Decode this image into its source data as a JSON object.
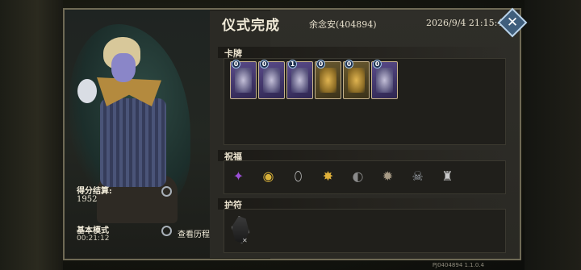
{
  "header": {
    "title": "仪式完成",
    "player": "余念安(404894)",
    "datetime": "2026/9/4 21:15:43"
  },
  "left": {
    "score_label": "得分结算:",
    "score_value": "1952",
    "mode_label": "基本模式",
    "mode_time": "00:21:12",
    "history_label": "查看历程"
  },
  "sections": {
    "cards": "卡牌",
    "blessings": "祝福",
    "amulet": "护符"
  },
  "cards": [
    {
      "cost": "0",
      "style": "purple",
      "icon": "vase-card-art"
    },
    {
      "cost": "0",
      "style": "purple",
      "icon": "scroll-card-art"
    },
    {
      "cost": "1",
      "style": "purple",
      "icon": "tentacle-card-art"
    },
    {
      "cost": "0",
      "style": "gold",
      "icon": "gold-figure-card-art"
    },
    {
      "cost": "0",
      "style": "gold",
      "icon": "gold-crab-card-art"
    },
    {
      "cost": "0",
      "style": "purple",
      "icon": "hand-card-art"
    }
  ],
  "blessings": [
    {
      "icon": "spellbook-icon",
      "glyph": "✦",
      "color": "#9b4fd6"
    },
    {
      "icon": "golden-eye-icon",
      "glyph": "◉",
      "color": "#d9b23a"
    },
    {
      "icon": "cracked-egg-icon",
      "glyph": "⬯",
      "color": "#b7b7b7"
    },
    {
      "icon": "golden-pinwheel-icon",
      "glyph": "✸",
      "color": "#e0b13a"
    },
    {
      "icon": "hand-mirror-icon",
      "glyph": "◐",
      "color": "#8a8a8a"
    },
    {
      "icon": "burst-emblem-icon",
      "glyph": "✹",
      "color": "#a89b86"
    },
    {
      "icon": "skull-flask-icon",
      "glyph": "☠",
      "color": "#9aa0a8"
    },
    {
      "icon": "hooded-figure-icon",
      "glyph": "♜",
      "color": "#c9c9c9"
    }
  ],
  "amulet": {
    "icon": "dark-talisman-icon",
    "mark": "✕"
  },
  "footer": {
    "version": "PJ0404894  1.1.0.4"
  },
  "colors": {
    "accent": "#3f5e7c",
    "panel": "#2b2a25",
    "border": "#6f6a55"
  }
}
